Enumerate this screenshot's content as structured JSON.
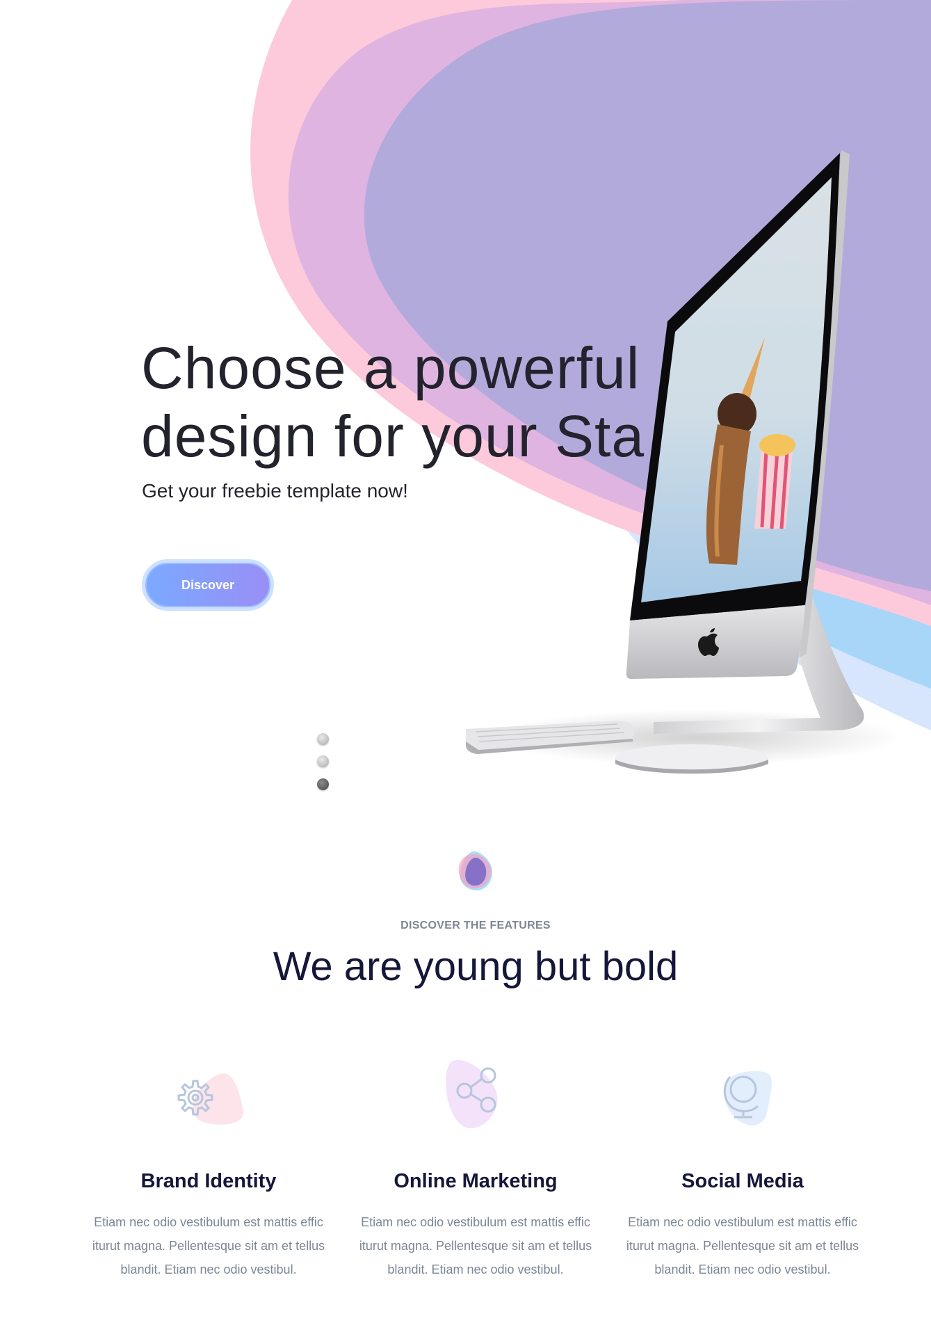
{
  "hero": {
    "title": "Choose a powerful\ndesign for your Sta",
    "subtitle": "Get your freebie template now!",
    "cta_label": "Discover",
    "slider_dot_count": 3,
    "slider_active_index": 2,
    "colors": {
      "pink_wave": "#fdcadb",
      "mauve_wave": "#e0b4e0",
      "lavender_wave": "#b3aadc",
      "light_blue_wave": "#a7d6f8",
      "pale_blue_wave": "#d7e6fd",
      "button_start": "#7aaaff",
      "button_end": "#9a8ef6"
    }
  },
  "features": {
    "eyebrow": "DISCOVER THE FEATURES",
    "heading": "We are young but bold",
    "items": [
      {
        "icon": "gear-icon",
        "title": "Brand Identity",
        "text": "Etiam nec odio vestibulum est mattis effic iturut magna. Pellentesque sit am et tellus blandit. Etiam nec odio vestibul."
      },
      {
        "icon": "share-icon",
        "title": "Online Marketing",
        "text": "Etiam nec odio vestibulum est mattis effic iturut magna. Pellentesque sit am et tellus blandit. Etiam nec odio vestibul."
      },
      {
        "icon": "globe-icon",
        "title": "Social Media",
        "text": "Etiam nec odio vestibulum est mattis effic iturut magna. Pellentesque sit am et tellus blandit. Etiam nec odio vestibul."
      }
    ]
  }
}
